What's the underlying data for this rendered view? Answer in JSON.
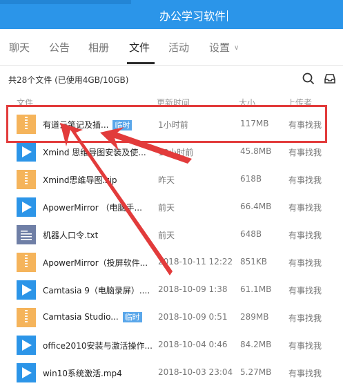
{
  "app": {
    "title": "办公学习软件"
  },
  "tabs": [
    {
      "label": "聊天",
      "active": false
    },
    {
      "label": "公告",
      "active": false
    },
    {
      "label": "相册",
      "active": false
    },
    {
      "label": "文件",
      "active": true
    },
    {
      "label": "活动",
      "active": false
    },
    {
      "label": "设置",
      "active": false
    }
  ],
  "summary": "共28个文件 (已使用4GB/10GB)",
  "columns": {
    "name": "文件",
    "time": "更新时间",
    "size": "大小",
    "uploader": "上传者"
  },
  "files": [
    {
      "name": "有道云笔记及插...",
      "badge": "临时",
      "time": "1小时前",
      "size": "117MB",
      "uploader": "有事找我",
      "icon": "zip-icon"
    },
    {
      "name": "Xmind 思维导图安装及使...",
      "badge": "",
      "time": "18小时前",
      "size": "45.8MB",
      "uploader": "有事找我",
      "icon": "video-icon"
    },
    {
      "name": "Xmind思维导图.zip",
      "badge": "",
      "time": "昨天",
      "size": "618B",
      "uploader": "有事找我",
      "icon": "zip-icon"
    },
    {
      "name": "ApowerMirror （电脑手...",
      "badge": "",
      "time": "前天",
      "size": "66.4MB",
      "uploader": "有事找我",
      "icon": "video-icon"
    },
    {
      "name": "机器人口令.txt",
      "badge": "",
      "time": "前天",
      "size": "648B",
      "uploader": "有事找我",
      "icon": "text-file-icon"
    },
    {
      "name": "ApowerMirror（投屏软件...",
      "badge": "",
      "time": "2018-10-11 12:22",
      "size": "851KB",
      "uploader": "有事找我",
      "icon": "zip-icon"
    },
    {
      "name": "Camtasia 9（电脑录屏）....",
      "badge": "",
      "time": "2018-10-09 1:38",
      "size": "61.1MB",
      "uploader": "有事找我",
      "icon": "video-icon"
    },
    {
      "name": "Camtasia Studio...",
      "badge": "临时",
      "time": "2018-10-09 0:51",
      "size": "289MB",
      "uploader": "有事找我",
      "icon": "zip-icon"
    },
    {
      "name": "office2010安装与激活操作...",
      "badge": "",
      "time": "2018-10-04 0:46",
      "size": "84.2MB",
      "uploader": "有事找我",
      "icon": "video-icon"
    },
    {
      "name": "win10系统激活.mp4",
      "badge": "",
      "time": "2018-10-03 23:04",
      "size": "5.27MB",
      "uploader": "有事找我",
      "icon": "video-icon"
    }
  ],
  "colors": {
    "titlebar": "#2b95e9",
    "highlight": "#e23b3b",
    "zip": "#f5b45b",
    "video": "#2c95e8",
    "badge": "#5aa7ea"
  }
}
